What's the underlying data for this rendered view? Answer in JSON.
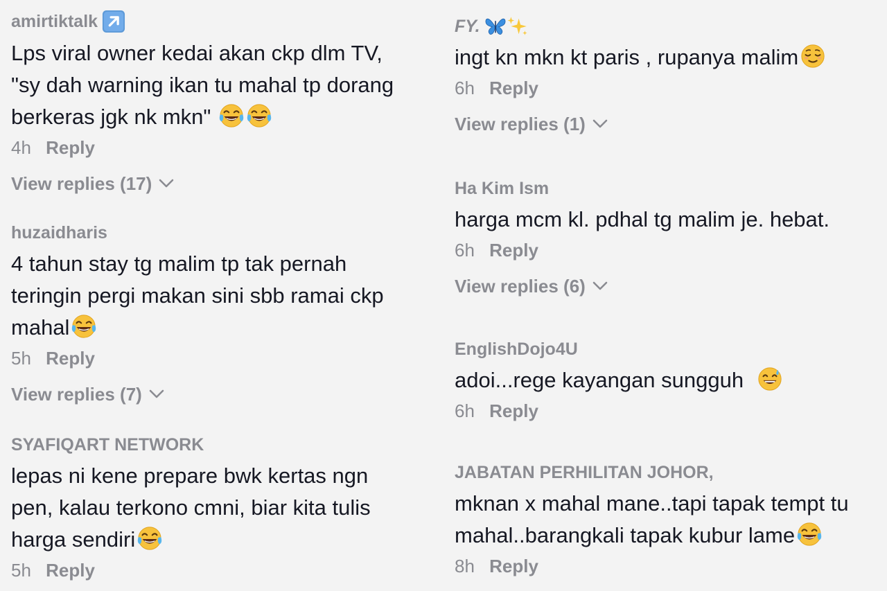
{
  "left_column": {
    "c1": {
      "username": "amirtiktalk",
      "badge_icon": "arrow-up-right-icon",
      "lines": [
        "Lps viral owner kedai akan ckp dlm TV,",
        "\"sy dah warning ikan tu mahal tp dorang",
        "berkeras jgk nk mkn\""
      ],
      "trailing_emoji": "tears-of-joy-icon",
      "time": "4h",
      "reply": "Reply",
      "view_replies": "View replies (17)"
    },
    "c2": {
      "username": "huzaidharis",
      "lines": [
        "4 tahun stay tg malim tp tak pernah",
        "teringin pergi makan sini sbb ramai ckp",
        "mahal"
      ],
      "trailing_emoji": "tears-of-joy-icon",
      "time": "5h",
      "reply": "Reply",
      "view_replies": "View replies (7)"
    },
    "c3": {
      "username": "SYAFIQART NETWORK",
      "lines": [
        "lepas ni kene prepare bwk kertas ngn",
        "pen, kalau terkono cmni, biar kita tulis",
        "harga sendiri"
      ],
      "trailing_emoji": "tears-of-joy-icon",
      "time": "5h",
      "reply": "Reply"
    }
  },
  "right_column": {
    "c4": {
      "username": "FY.",
      "username_emojis": [
        "butterfly-icon",
        "sparkles-icon"
      ],
      "lines": [
        "ingt kn mkn kt paris , rupanya malim"
      ],
      "trailing_emoji": "relieved-face-icon",
      "time": "6h",
      "reply": "Reply",
      "view_replies": "View replies (1)"
    },
    "c5": {
      "username": "Ha Kim Ism",
      "lines": [
        "harga mcm kl. pdhal tg malim je. hebat."
      ],
      "time": "6h",
      "reply": "Reply",
      "view_replies": "View replies (6)"
    },
    "c6": {
      "username": "EnglishDojo4U",
      "lines": [
        "adoi...rege kayangan sungguh "
      ],
      "trailing_emoji": "grinning-sweat-icon",
      "time": "6h",
      "reply": "Reply"
    },
    "c7": {
      "username": "JABATAN PERHILITAN JOHOR,",
      "lines": [
        "mknan x mahal mane..tapi tapak tempt tu",
        "mahal..barangkali tapak kubur lame"
      ],
      "trailing_emoji": "tears-of-joy-icon",
      "time": "8h",
      "reply": "Reply"
    }
  },
  "colors": {
    "background": "#f3f3f3",
    "text": "#161823",
    "muted": "#8a8b91"
  }
}
